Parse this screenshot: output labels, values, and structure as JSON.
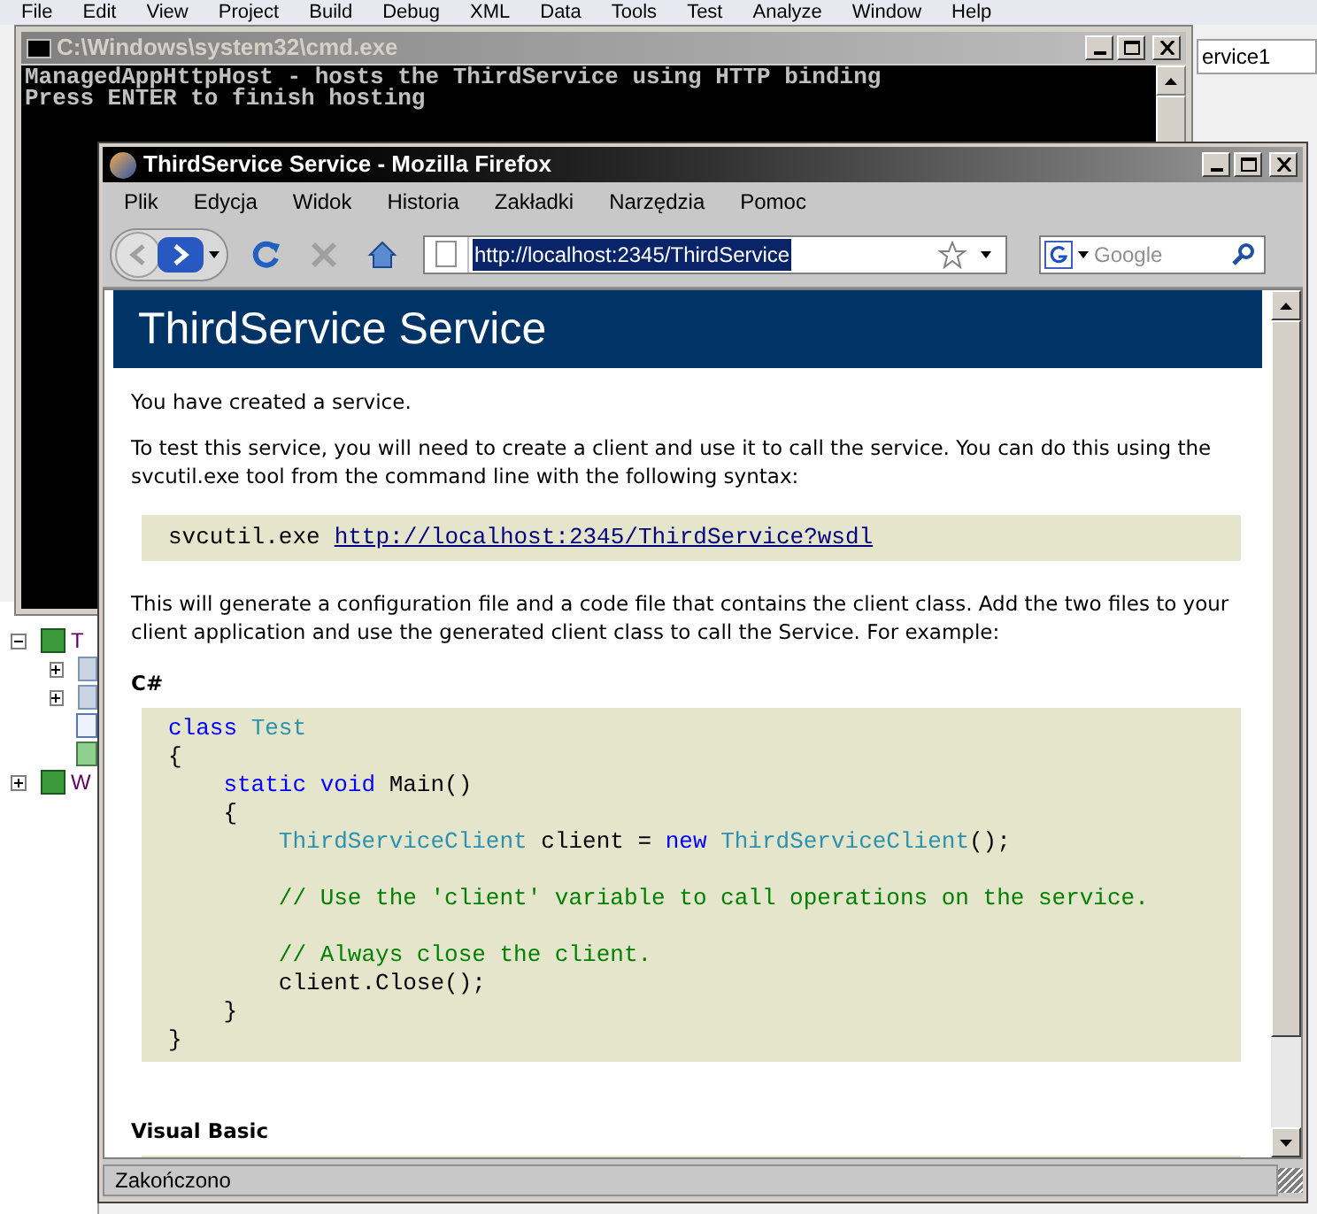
{
  "ide": {
    "menu": [
      "File",
      "Edit",
      "View",
      "Project",
      "Build",
      "Debug",
      "XML",
      "Data",
      "Tools",
      "Test",
      "Analyze",
      "Window",
      "Help"
    ],
    "tab": "ervice1",
    "tree": [
      {
        "label": "T",
        "kind": "project",
        "expanded": true,
        "children": [
          {
            "kind": "folder",
            "expanded": false
          },
          {
            "kind": "folder",
            "expanded": false
          },
          {
            "kind": "file"
          },
          {
            "kind": "code"
          }
        ]
      },
      {
        "label": "W",
        "kind": "project",
        "expanded": false
      }
    ]
  },
  "console": {
    "title": "C:\\Windows\\system32\\cmd.exe",
    "lines": [
      "ManagedAppHttpHost - hosts the ThirdService using HTTP binding",
      "Press ENTER to finish hosting"
    ]
  },
  "browser": {
    "title": "ThirdService Service - Mozilla Firefox",
    "menu": [
      "Plik",
      "Edycja",
      "Widok",
      "Historia",
      "Zakładki",
      "Narzędzia",
      "Pomoc"
    ],
    "address": "http://localhost:2345/ThirdService",
    "search_placeholder": "Google",
    "page": {
      "heading": "ThirdService Service",
      "intro": "You have created a service.",
      "instructions": "To test this service, you will need to create a client and use it to call the service. You can do this using the svcutil.exe tool from the command line with the following syntax:",
      "command": {
        "tool": "svcutil.exe",
        "link": "http://localhost:2345/ThirdService?wsdl"
      },
      "explanation": "This will generate a configuration file and a code file that contains the client class. Add the two files to your client application and use the generated client class to call the Service. For example:",
      "sections": [
        {
          "title": "C#",
          "code": [
            [
              {
                "kind": "keyword",
                "text": "class"
              },
              {
                "kind": "type",
                "text": " Test"
              }
            ],
            [
              {
                "kind": "plain",
                "text": "{"
              }
            ],
            [
              {
                "kind": "keyword",
                "text": "    static"
              },
              {
                "kind": "keyword",
                "text": " void"
              },
              {
                "kind": "plain",
                "text": " Main()"
              }
            ],
            [
              {
                "kind": "plain",
                "text": "    {"
              }
            ],
            [
              {
                "kind": "type",
                "text": "        ThirdServiceClient"
              },
              {
                "kind": "plain",
                "text": " client = "
              },
              {
                "kind": "keyword",
                "text": "new"
              },
              {
                "kind": "type",
                "text": " ThirdServiceClient"
              },
              {
                "kind": "plain",
                "text": "();"
              }
            ],
            [
              {
                "kind": "blank"
              }
            ],
            [
              {
                "kind": "comment",
                "text": "        // Use the 'client' variable to call operations on the service."
              }
            ],
            [
              {
                "kind": "blank"
              }
            ],
            [
              {
                "kind": "comment",
                "text": "        // Always close the client."
              }
            ],
            [
              {
                "kind": "plain",
                "text": "        client.Close();"
              }
            ],
            [
              {
                "kind": "plain",
                "text": "    }"
              }
            ],
            [
              {
                "kind": "plain",
                "text": "}"
              }
            ]
          ]
        },
        {
          "title": "Visual Basic"
        }
      ]
    },
    "status": "Zakończono"
  }
}
